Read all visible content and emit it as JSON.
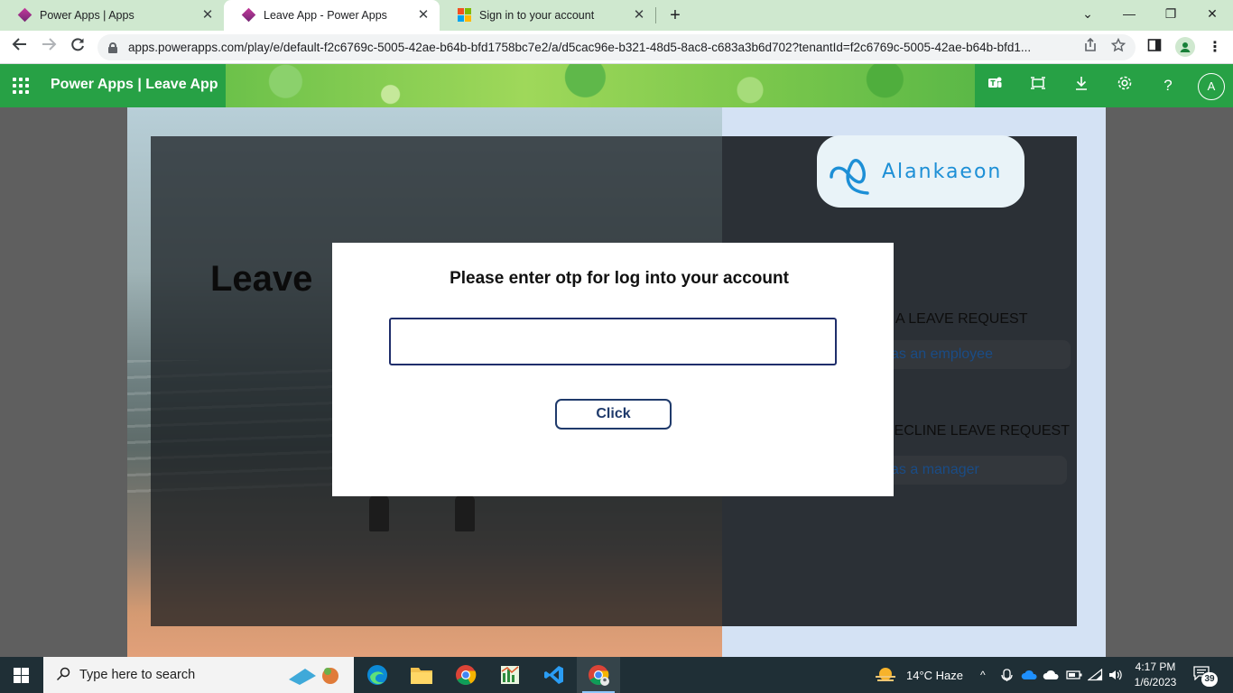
{
  "browser": {
    "tabs": [
      {
        "title": "Power Apps | Apps",
        "active": false,
        "favicon": "powerapps-icon"
      },
      {
        "title": "Leave App - Power Apps",
        "active": true,
        "favicon": "powerapps-icon"
      },
      {
        "title": "Sign in to your account",
        "active": false,
        "favicon": "microsoft-icon"
      }
    ],
    "new_tab_glyph": "+",
    "close_glyph": "✕",
    "url": "apps.powerapps.com/play/e/default-f2c6769c-5005-42ae-b64b-bfd1758bc7e2/a/d5cac96e-b321-48d5-8ac8-c683a3b6d702?tenantId=f2c6769c-5005-42ae-b64b-bfd1...",
    "window_controls": {
      "minimize": "—",
      "restore": "❐",
      "close": "✕",
      "tab_search": "⌄"
    }
  },
  "powerapps": {
    "title": "Power Apps  |  Leave App",
    "avatar_initial": "A"
  },
  "app": {
    "logo_text": "Alankaeon",
    "heading": "Leave",
    "employee_label": "T A LEAVE REQUEST",
    "employee_button": "as an employee",
    "manager_label": "DECLINE LEAVE REQUEST",
    "manager_button": "as a manager"
  },
  "modal": {
    "title": "Please enter otp for log into your account",
    "input_value": "",
    "input_placeholder": "",
    "button_label": "Click"
  },
  "taskbar": {
    "search_placeholder": "Type here to search",
    "weather": "14°C  Haze",
    "time": "4:17 PM",
    "date": "1/6/2023",
    "notification_count": "39"
  },
  "colors": {
    "powerapps_green": "#27a145",
    "modal_border": "#1f2e6b",
    "logo_blue": "#1d8fd6"
  }
}
